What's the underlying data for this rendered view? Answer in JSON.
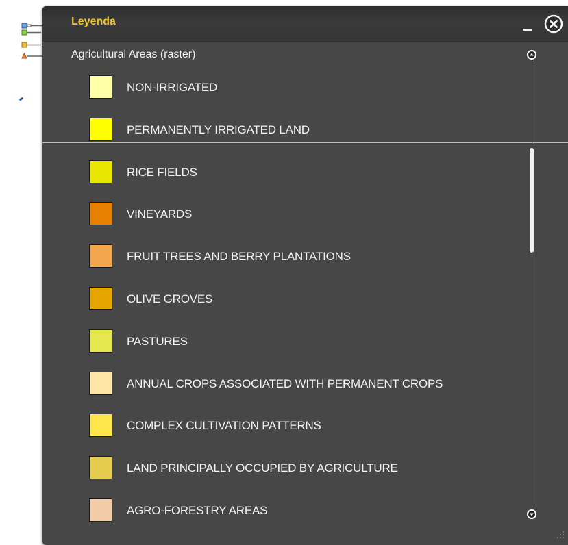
{
  "panel": {
    "title": "Leyenda",
    "title_color": "#f2c62a",
    "background": "#474747"
  },
  "layer": {
    "title": "Agricultural Areas (raster)"
  },
  "legend_items": [
    {
      "label": "NON-IRRIGATED",
      "color": "#ffffa8"
    },
    {
      "label": "PERMANENTLY IRRIGATED LAND",
      "color": "#ffff00"
    },
    {
      "label": "RICE FIELDS",
      "color": "#e6e600"
    },
    {
      "label": "VINEYARDS",
      "color": "#e68000"
    },
    {
      "label": "FRUIT TREES AND BERRY PLANTATIONS",
      "color": "#f2a64d"
    },
    {
      "label": "OLIVE GROVES",
      "color": "#e6a600"
    },
    {
      "label": "PASTURES",
      "color": "#e6e64d"
    },
    {
      "label": "ANNUAL CROPS ASSOCIATED WITH PERMANENT CROPS",
      "color": "#ffe6a6"
    },
    {
      "label": "COMPLEX CULTIVATION PATTERNS",
      "color": "#ffe64d"
    },
    {
      "label": "LAND PRINCIPALLY OCCUPIED BY AGRICULTURE",
      "color": "#e6cc4d"
    },
    {
      "label": "AGRO-FORESTRY AREAS",
      "color": "#f2cca6"
    }
  ],
  "icons": {
    "legend_toggle": "legend-layers-icon",
    "minimize": "minimize-icon",
    "close": "close-circle-icon",
    "scroll_up": "scroll-up-icon",
    "scroll_down": "scroll-down-icon",
    "resize": "resize-grip-icon"
  }
}
